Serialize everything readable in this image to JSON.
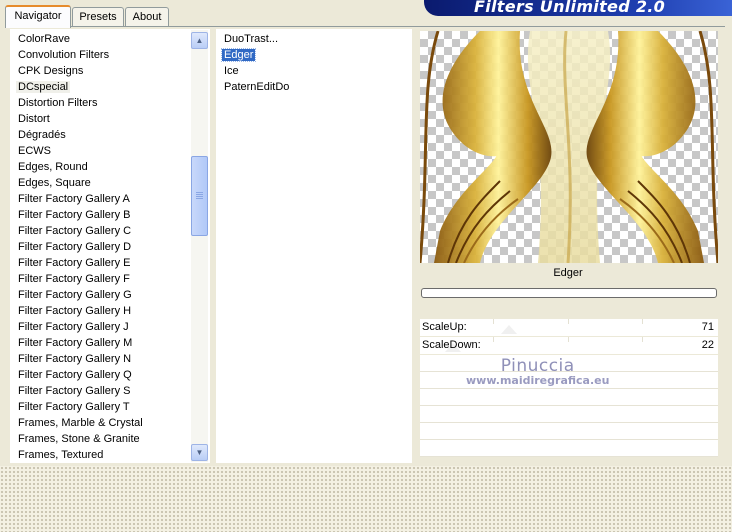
{
  "header": {
    "title": "Filters Unlimited 2.0"
  },
  "tabs": [
    {
      "label": "Navigator",
      "active": true
    },
    {
      "label": "Presets",
      "active": false
    },
    {
      "label": "About",
      "active": false
    }
  ],
  "categories": {
    "items": [
      "ColorRave",
      "Convolution Filters",
      "CPK Designs",
      "DCspecial",
      "Distortion Filters",
      "Distort",
      "Dégradés",
      "ECWS",
      "Edges, Round",
      "Edges, Square",
      "Filter Factory Gallery A",
      "Filter Factory Gallery B",
      "Filter Factory Gallery C",
      "Filter Factory Gallery D",
      "Filter Factory Gallery E",
      "Filter Factory Gallery F",
      "Filter Factory Gallery G",
      "Filter Factory Gallery H",
      "Filter Factory Gallery J",
      "Filter Factory Gallery M",
      "Filter Factory Gallery N",
      "Filter Factory Gallery Q",
      "Filter Factory Gallery S",
      "Filter Factory Gallery T",
      "Frames, Marble & Crystal",
      "Frames, Stone & Granite",
      "Frames, Textured"
    ],
    "selected": "DCspecial"
  },
  "filters": {
    "items": [
      "DuoTrast...",
      "Edger",
      "Ice",
      "PaternEditDo"
    ],
    "selected": "Edger"
  },
  "preview": {
    "filter_name": "Edger"
  },
  "params": [
    {
      "label": "ScaleUp:",
      "value": "71",
      "level": 71
    },
    {
      "label": "ScaleDown:",
      "value": "22",
      "level": 22
    }
  ],
  "watermark": {
    "name": "Pinuccia",
    "url": "www.maidiregrafica.eu"
  },
  "colors": {
    "accent": "#316ac5",
    "banner": "#1f3fb0",
    "tab_highlight": "#e68b2c"
  }
}
